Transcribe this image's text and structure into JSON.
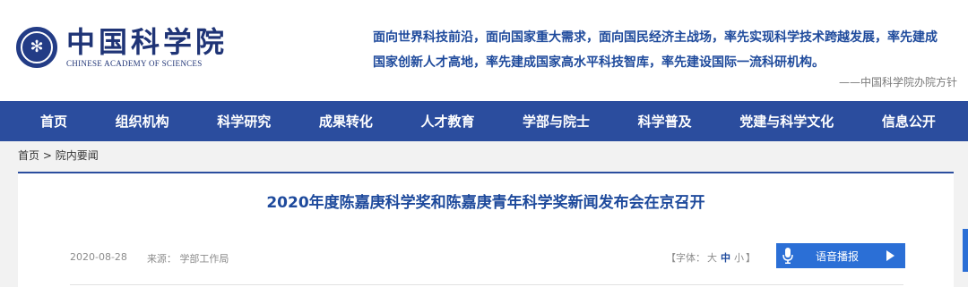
{
  "header": {
    "logo_cn": "中国科学院",
    "logo_en": "CHINESE ACADEMY OF SCIENCES",
    "slogan_line1": "面向世界科技前沿，面向国家重大需求，面向国民经济主战场，率先实现科学技术跨越发展，率先建成",
    "slogan_line2": "国家创新人才高地，率先建成国家高水平科技智库，率先建设国际一流科研机构。",
    "slogan_source": "——中国科学院办院方针"
  },
  "nav": {
    "items": [
      "首页",
      "组织机构",
      "科学研究",
      "成果转化",
      "人才教育",
      "学部与院士",
      "科学普及",
      "党建与科学文化",
      "信息公开"
    ]
  },
  "breadcrumb": {
    "home": "首页",
    "separator": " > ",
    "current": "院内要闻"
  },
  "article": {
    "title": "2020年度陈嘉庚科学奖和陈嘉庚青年科学奖新闻发布会在京召开",
    "date": "2020-08-28",
    "source_label": "来源：",
    "source": "学部工作局",
    "font_size_prefix": "【字体：",
    "font_large": "大",
    "font_medium": "中",
    "font_small": "小",
    "font_size_suffix": "】",
    "audio_label": "语音播报"
  },
  "colors": {
    "nav_bg": "#2b4d9e",
    "brand_blue": "#1e4a9c",
    "audio_btn": "#2b6fd6"
  }
}
